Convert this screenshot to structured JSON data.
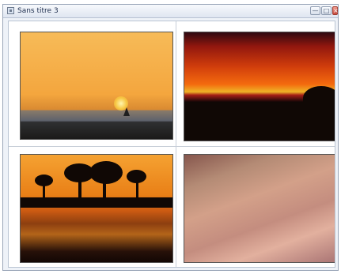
{
  "window": {
    "title": "Sans titre 3",
    "controls": {
      "minimize": "—",
      "maximize": "□",
      "close": "×"
    }
  },
  "canvas": {
    "photos": [
      {
        "name": "sunset-sea"
      },
      {
        "name": "sunset-cliffs"
      },
      {
        "name": "sunset-trees"
      },
      {
        "name": "pink-clouds"
      }
    ]
  },
  "colors": {
    "titlebar_top": "#f7f9fc",
    "titlebar_bottom": "#dfe6f1",
    "window_border": "#9aa6b8",
    "canvas_border": "#bac5d3",
    "divider": "#c7ced8"
  }
}
